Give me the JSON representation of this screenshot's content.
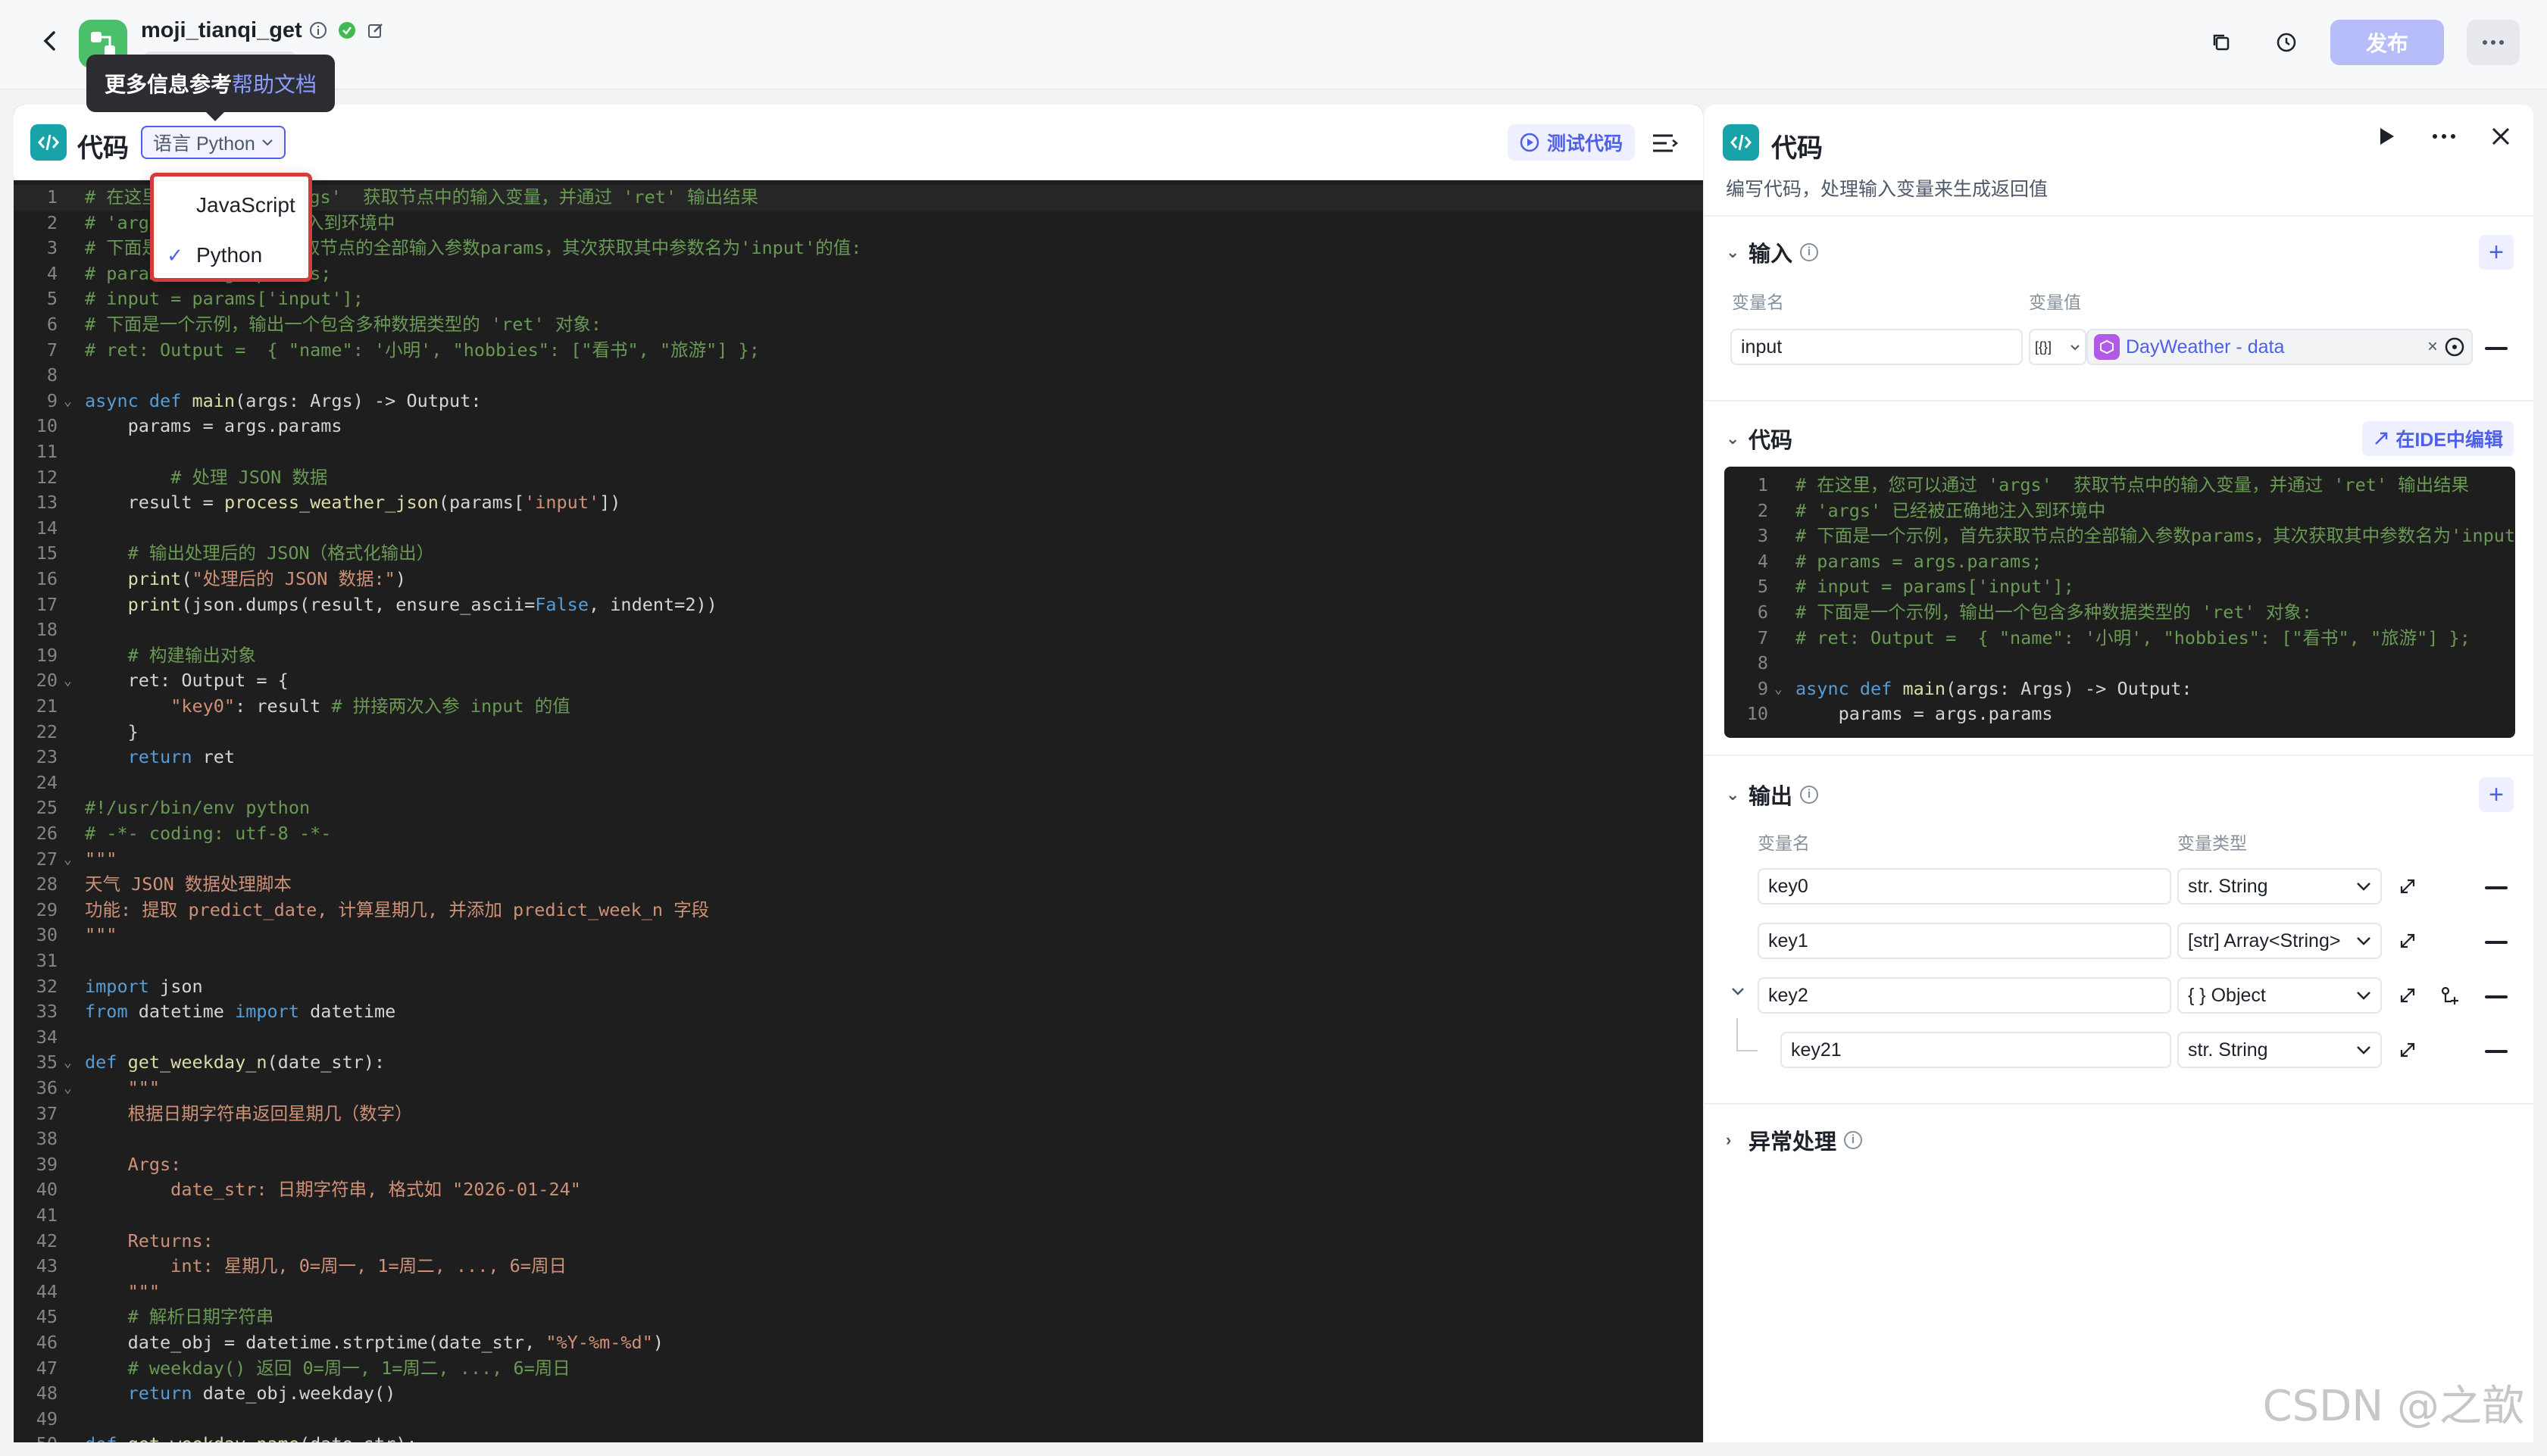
{
  "topbar": {
    "app_title": "moji_tianqi_get",
    "publish_label": "发布"
  },
  "tooltip": {
    "text": "更多信息参考",
    "link": "帮助文档"
  },
  "code_panel": {
    "title": "代码",
    "language_label": "语言 Python",
    "test_label": "测试代码",
    "dropdown": [
      "JavaScript",
      "Python"
    ],
    "lines": [
      [
        {
          "t": "# 在这里，您可以通过 'args'  获取节点中的输入变量，并通过 'ret' 输出结果",
          "c": "cmt"
        }
      ],
      [
        {
          "t": "# 'args' 已经被正确地注入到环境中",
          "c": "cmt"
        }
      ],
      [
        {
          "t": "# 下面是一个示例，首先获取节点的全部输入参数params，其次获取其中参数名为'input'的值:",
          "c": "cmt"
        }
      ],
      [
        {
          "t": "# params = args.params;",
          "c": "cmt"
        }
      ],
      [
        {
          "t": "# input = params['input'];",
          "c": "cmt"
        }
      ],
      [
        {
          "t": "# 下面是一个示例，输出一个包含多种数据类型的 'ret' 对象:",
          "c": "cmt"
        }
      ],
      [
        {
          "t": "# ret: Output =  { \"name\": '小明', \"hobbies\": [\"看书\", \"旅游\"] };",
          "c": "cmt"
        }
      ],
      [],
      [
        {
          "t": "async def ",
          "c": "kw"
        },
        {
          "t": "main",
          "c": "fn"
        },
        {
          "t": "(args: Args) -> Output:",
          "c": ""
        }
      ],
      [
        {
          "t": "    params = args.params",
          "c": ""
        }
      ],
      [],
      [
        {
          "t": "        # 处理 JSON 数据",
          "c": "cmt"
        }
      ],
      [
        {
          "t": "    result = ",
          "c": ""
        },
        {
          "t": "process_weather_json",
          "c": "fn"
        },
        {
          "t": "(params[",
          "c": ""
        },
        {
          "t": "'input'",
          "c": "str"
        },
        {
          "t": "])",
          "c": ""
        }
      ],
      [],
      [
        {
          "t": "    # 输出处理后的 JSON（格式化输出）",
          "c": "cmt"
        }
      ],
      [
        {
          "t": "    ",
          "c": ""
        },
        {
          "t": "print",
          "c": "fn"
        },
        {
          "t": "(",
          "c": ""
        },
        {
          "t": "\"处理后的 JSON 数据:\"",
          "c": "str"
        },
        {
          "t": ")",
          "c": ""
        }
      ],
      [
        {
          "t": "    ",
          "c": ""
        },
        {
          "t": "print",
          "c": "fn"
        },
        {
          "t": "(json.dumps(result, ensure_ascii=",
          "c": ""
        },
        {
          "t": "False",
          "c": "kw"
        },
        {
          "t": ", indent=2))",
          "c": ""
        }
      ],
      [],
      [
        {
          "t": "    # 构建输出对象",
          "c": "cmt"
        }
      ],
      [
        {
          "t": "    ret: Output = {",
          "c": ""
        }
      ],
      [
        {
          "t": "        ",
          "c": ""
        },
        {
          "t": "\"key0\"",
          "c": "str"
        },
        {
          "t": ": result ",
          "c": ""
        },
        {
          "t": "# 拼接两次入参 input 的值",
          "c": "cmt"
        }
      ],
      [
        {
          "t": "    }",
          "c": ""
        }
      ],
      [
        {
          "t": "    return ",
          "c": "kw"
        },
        {
          "t": "ret",
          "c": ""
        }
      ],
      [],
      [
        {
          "t": "#!/usr/bin/env python",
          "c": "cmt"
        }
      ],
      [
        {
          "t": "# -*- coding: utf-8 -*-",
          "c": "cmt"
        }
      ],
      [
        {
          "t": "\"\"\"",
          "c": "str"
        }
      ],
      [
        {
          "t": "天气 JSON 数据处理脚本",
          "c": "str"
        }
      ],
      [
        {
          "t": "功能: 提取 predict_date, 计算星期几, 并添加 predict_week_n 字段",
          "c": "str"
        }
      ],
      [
        {
          "t": "\"\"\"",
          "c": "str"
        }
      ],
      [],
      [
        {
          "t": "import ",
          "c": "kw"
        },
        {
          "t": "json",
          "c": ""
        }
      ],
      [
        {
          "t": "from ",
          "c": "kw"
        },
        {
          "t": "datetime ",
          "c": ""
        },
        {
          "t": "import ",
          "c": "kw"
        },
        {
          "t": "datetime",
          "c": ""
        }
      ],
      [],
      [
        {
          "t": "def ",
          "c": "kw"
        },
        {
          "t": "get_weekday_n",
          "c": "fn"
        },
        {
          "t": "(date_str):",
          "c": ""
        }
      ],
      [
        {
          "t": "    \"\"\"",
          "c": "str"
        }
      ],
      [
        {
          "t": "    根据日期字符串返回星期几（数字）",
          "c": "str"
        }
      ],
      [],
      [
        {
          "t": "    Args:",
          "c": "str"
        }
      ],
      [
        {
          "t": "        date_str: 日期字符串, 格式如 \"2026-01-24\"",
          "c": "str"
        }
      ],
      [],
      [
        {
          "t": "    Returns:",
          "c": "str"
        }
      ],
      [
        {
          "t": "        int: 星期几, 0=周一, 1=周二, ..., 6=周日",
          "c": "str"
        }
      ],
      [
        {
          "t": "    \"\"\"",
          "c": "str"
        }
      ],
      [
        {
          "t": "    # 解析日期字符串",
          "c": "cmt"
        }
      ],
      [
        {
          "t": "    date_obj = datetime.strptime(date_str, ",
          "c": ""
        },
        {
          "t": "\"%Y-%m-%d\"",
          "c": "str"
        },
        {
          "t": ")",
          "c": ""
        }
      ],
      [
        {
          "t": "    # weekday() 返回 0=周一, 1=周二, ..., 6=周日",
          "c": "cmt"
        }
      ],
      [
        {
          "t": "    return ",
          "c": "kw"
        },
        {
          "t": "date_obj.weekday()",
          "c": ""
        }
      ],
      [],
      [
        {
          "t": "def ",
          "c": "kw"
        },
        {
          "t": "get_weekday_name",
          "c": "fn"
        },
        {
          "t": "(date_str):",
          "c": ""
        }
      ]
    ],
    "fold_lines": [
      9,
      20,
      27,
      35,
      36
    ]
  },
  "right_panel": {
    "title": "代码",
    "description": "编写代码，处理输入变量来生成返回值",
    "input_section": {
      "title": "输入",
      "col_name": "变量名",
      "col_value": "变量值",
      "row_name": "input",
      "ref_type": "[{}]",
      "ref_value": "DayWeather - data"
    },
    "code_section": {
      "title": "代码",
      "ide_label": "在IDE中编辑",
      "lines": [
        [
          {
            "t": "# 在这里，您可以通过 'args'  获取节点中的输入变量，并通过 'ret' 输出结果",
            "c": "cmt"
          }
        ],
        [
          {
            "t": "# 'args' 已经被正确地注入到环境中",
            "c": "cmt"
          }
        ],
        [
          {
            "t": "# 下面是一个示例，首先获取节点的全部输入参数params，其次获取其中参数名为'input'的值:",
            "c": "cmt"
          }
        ],
        [
          {
            "t": "# params = args.params;",
            "c": "cmt"
          }
        ],
        [
          {
            "t": "# input = params['input'];",
            "c": "cmt"
          }
        ],
        [
          {
            "t": "# 下面是一个示例，输出一个包含多种数据类型的 'ret' 对象:",
            "c": "cmt"
          }
        ],
        [
          {
            "t": "# ret: Output =  { \"name\": '小明', \"hobbies\": [\"看书\", \"旅游\"] };",
            "c": "cmt"
          }
        ],
        [],
        [
          {
            "t": "async def ",
            "c": "kw"
          },
          {
            "t": "main",
            "c": "fn"
          },
          {
            "t": "(args: Args) -> Output:",
            "c": ""
          }
        ],
        [
          {
            "t": "    params = args.params",
            "c": ""
          }
        ]
      ]
    },
    "output_section": {
      "title": "输出",
      "col_name": "变量名",
      "col_type": "变量类型",
      "rows": [
        {
          "name": "key0",
          "type": "str. String"
        },
        {
          "name": "key1",
          "type": "[str] Array<String>"
        },
        {
          "name": "key2",
          "type": "{ } Object"
        },
        {
          "name": "key21",
          "type": "str. String"
        }
      ]
    },
    "error_section": {
      "title": "异常处理"
    }
  },
  "watermark": "CSDN @之歆"
}
